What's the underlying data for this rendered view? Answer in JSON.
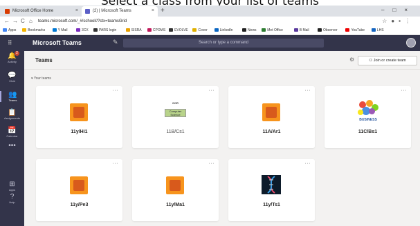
{
  "caption": "Select a class from your list of teams",
  "browser": {
    "tabs": [
      {
        "title": "Microsoft Office Home",
        "color": "#d83b01"
      },
      {
        "title": "(2) | Microsoft Teams",
        "color": "#5b5fc7"
      }
    ],
    "new_tab": "+",
    "url": "teams.microsoft.com/_#/school//?ctx=teamsGrid",
    "bookmarks": [
      {
        "label": "Apps",
        "color": "#4285f4"
      },
      {
        "label": "Bookmarks",
        "color": "#f4b400"
      },
      {
        "label": "Y Mail",
        "color": "#0078d4"
      },
      {
        "label": "3CX",
        "color": "#7b2cbf"
      },
      {
        "label": "PARS login",
        "color": "#333"
      },
      {
        "label": "SISRA",
        "color": "#e9a100"
      },
      {
        "label": "CPOMS",
        "color": "#c2185b"
      },
      {
        "label": "EVOLVE",
        "color": "#333"
      },
      {
        "label": "Cover",
        "color": "#e0b000"
      },
      {
        "label": "LinkedIn",
        "color": "#0a66c2"
      },
      {
        "label": "News",
        "color": "#222"
      },
      {
        "label": "Met Office",
        "color": "#2e7d32"
      },
      {
        "label": "B Mail",
        "color": "#5b3a9e"
      },
      {
        "label": "Observer",
        "color": "#222"
      },
      {
        "label": "YouTube",
        "color": "#e00"
      },
      {
        "label": "LHS",
        "color": "#1565c0"
      }
    ]
  },
  "teams": {
    "brand": "Microsoft Teams",
    "search_placeholder": "Search or type a command",
    "rail": [
      {
        "label": "Activity",
        "icon": "bell-icon",
        "glyph": "🔔",
        "badge": "2"
      },
      {
        "label": "Chat",
        "icon": "chat-icon",
        "glyph": "💬"
      },
      {
        "label": "Teams",
        "icon": "teams-icon",
        "glyph": "👥",
        "active": true
      },
      {
        "label": "Assignments",
        "icon": "assignments-icon",
        "glyph": "📋"
      },
      {
        "label": "Calendar",
        "icon": "calendar-icon",
        "glyph": "📅"
      },
      {
        "label": "",
        "icon": "more-icon",
        "glyph": "•••"
      },
      {
        "label": "Apps",
        "icon": "apps-icon",
        "glyph": "⊞"
      },
      {
        "label": "Help",
        "icon": "help-icon",
        "glyph": "?"
      }
    ],
    "page_title": "Teams",
    "join_button": "Join or create team",
    "section_label": "Your teams",
    "cards": [
      {
        "name": "11y/Hi1",
        "logo": "orange"
      },
      {
        "name": "11B/Cs1",
        "logo": "ocr",
        "logo_title": "OCR",
        "logo_text": "Computer Science"
      },
      {
        "name": "11A/Ar1",
        "logo": "orange"
      },
      {
        "name": "11C/Bs1",
        "logo": "business",
        "logo_text": "BUSINESS"
      },
      {
        "name": "11y/Pe3",
        "logo": "orange"
      },
      {
        "name": "11y/Ma1",
        "logo": "orange"
      },
      {
        "name": "11y/Ts1",
        "logo": "dna"
      }
    ],
    "colors": {
      "header": "#33344a",
      "accent": "#f7941d",
      "background": "#f3f2f1"
    }
  }
}
